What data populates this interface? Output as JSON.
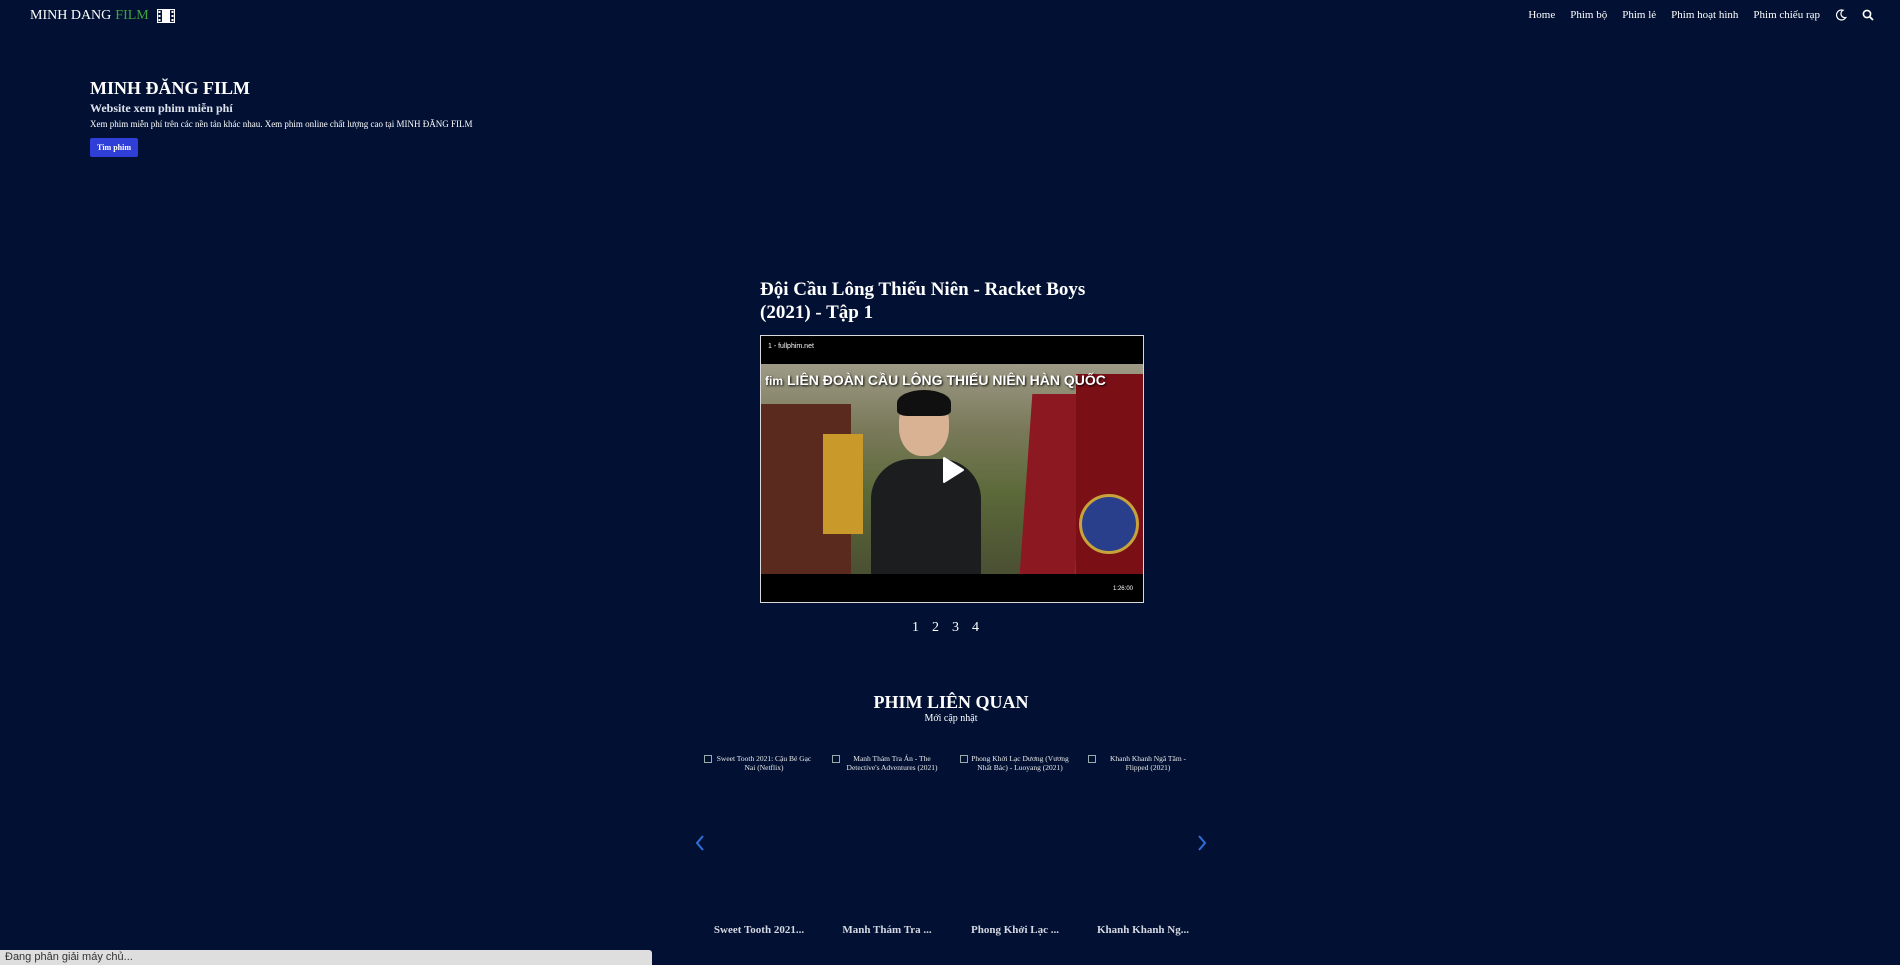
{
  "brand": {
    "part1": "MINH DANG ",
    "part2": "FILM"
  },
  "nav": {
    "links": [
      "Home",
      "Phim bộ",
      "Phim lẻ",
      "Phim hoạt hình",
      "Phim chiếu rạp"
    ]
  },
  "hero": {
    "title": "MINH ĐĂNG FILM",
    "subtitle": "Website xem phim miễn phí",
    "description": "Xem phim miễn phí trên các nền tản khác nhau. Xem phim online chất lượng cao tại MINH ĐĂNG FILM",
    "button": "Tìm phim"
  },
  "episode": {
    "title": "Đội Cầu Lông Thiếu Niên - Racket Boys (2021) - Tập 1",
    "player": {
      "source": "1 - fullphim.net",
      "logo_tag": "fim",
      "overlay": "LIÊN ĐOÀN CẦU LÔNG THIẾU NIÊN HÀN QUỐC",
      "duration": "1:26:00"
    },
    "pages": [
      "1",
      "2",
      "3",
      "4"
    ]
  },
  "related": {
    "title": "PHIM LIÊN QUAN",
    "subtitle": "Mới cập nhật",
    "items": [
      {
        "alt": "Sweet Tooth 2021: Cậu Bé Gạc Nai (Netflix)",
        "name": "Sweet Tooth 2021..."
      },
      {
        "alt": "Manh Thám Tra Án - The Detective's Adventures (2021)",
        "name": "Manh Thám Tra ..."
      },
      {
        "alt": "Phong Khởi Lạc Dương (Vương Nhất Bác) - Luoyang (2021)",
        "name": "Phong Khởi Lạc ..."
      },
      {
        "alt": "Khanh Khanh Ngã Tâm - Flipped (2021)",
        "name": "Khanh Khanh Ng..."
      }
    ]
  },
  "status": "Đang phân giải máy chủ...",
  "colors": {
    "background": "#021133",
    "accent": "#3ea63e",
    "button": "#2e3ed6",
    "arrow": "#2f6fd8"
  }
}
